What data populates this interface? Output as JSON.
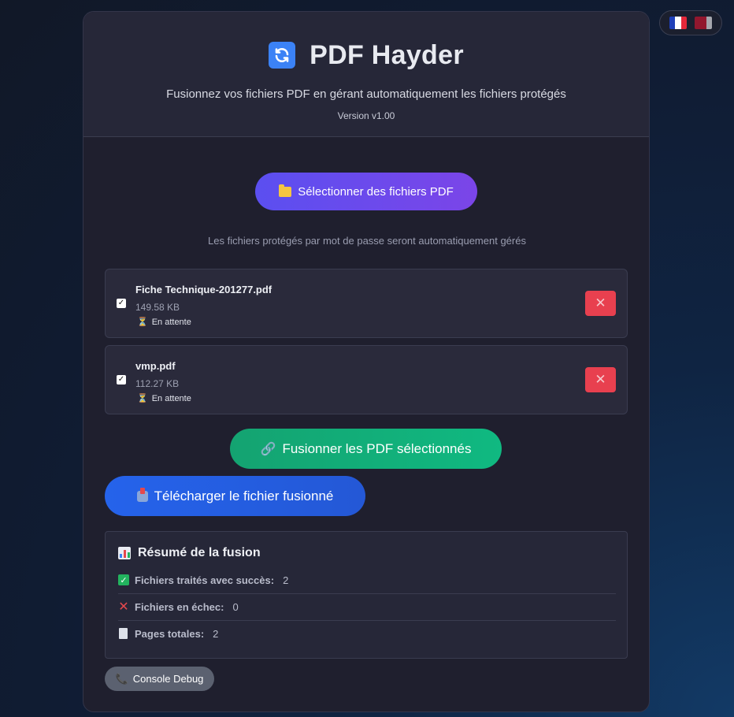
{
  "language_switcher": {
    "options": [
      "fr",
      "other"
    ]
  },
  "header": {
    "title": "PDF Hayder",
    "subtitle": "Fusionnez vos fichiers PDF en gérant automatiquement les fichiers protégés",
    "version": "Version v1.00"
  },
  "select_button": {
    "label": "Sélectionner des fichiers PDF"
  },
  "hint": "Les fichiers protégés par mot de passe seront automatiquement gérés",
  "files": [
    {
      "name": "Fiche Technique-201277.pdf",
      "size": "149.58 KB",
      "status": "En attente",
      "checked": true
    },
    {
      "name": "vmp.pdf",
      "size": "112.27 KB",
      "status": "En attente",
      "checked": true
    }
  ],
  "merge_button": {
    "label": "Fusionner les PDF sélectionnés"
  },
  "download_button": {
    "label": "Télécharger le fichier fusionné"
  },
  "summary": {
    "title": "Résumé de la fusion",
    "rows": [
      {
        "label": "Fichiers traités avec succès:",
        "value": "2",
        "icon": "check-icon"
      },
      {
        "label": "Fichiers en échec:",
        "value": "0",
        "icon": "cross-icon"
      },
      {
        "label": "Pages totales:",
        "value": "2",
        "icon": "page-icon"
      }
    ]
  },
  "debug_button": {
    "label": "Console Debug"
  },
  "colors": {
    "primary_purple": "#5b4ff0",
    "success_green": "#10b981",
    "download_blue": "#2563eb",
    "danger_red": "#e8404f",
    "card_bg": "#1f1f2e"
  }
}
